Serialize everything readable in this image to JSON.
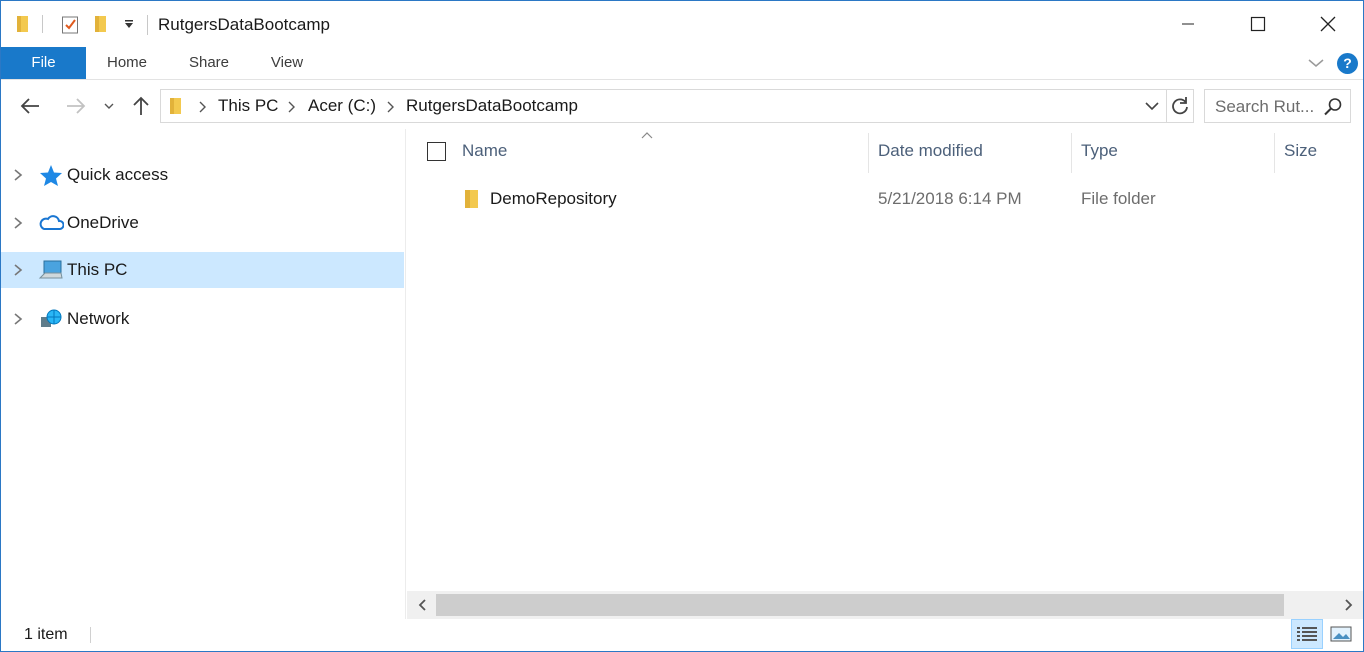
{
  "window": {
    "title": "RutgersDataBootcamp",
    "controls": {
      "minimize": "minimize-icon",
      "maximize": "maximize-icon",
      "close": "close-icon"
    }
  },
  "quick_access_toolbar": [
    "folder-icon",
    "properties-icon",
    "new-folder-icon",
    "customize-dropdown-icon"
  ],
  "ribbon": {
    "tabs": [
      {
        "label": "File",
        "active": true
      },
      {
        "label": "Home"
      },
      {
        "label": "Share"
      },
      {
        "label": "View"
      }
    ],
    "help_label": "?"
  },
  "nav": {
    "breadcrumbs": [
      "This PC",
      "Acer (C:)",
      "RutgersDataBootcamp"
    ],
    "search_placeholder": "Search Rut..."
  },
  "nav_pane": {
    "items": [
      {
        "label": "Quick access",
        "icon": "star-icon",
        "selected": false
      },
      {
        "label": "OneDrive",
        "icon": "cloud-icon",
        "selected": false
      },
      {
        "label": "This PC",
        "icon": "computer-icon",
        "selected": true
      },
      {
        "label": "Network",
        "icon": "network-icon",
        "selected": false
      }
    ]
  },
  "file_list": {
    "columns": [
      "Name",
      "Date modified",
      "Type",
      "Size"
    ],
    "sort_column": "Name",
    "rows": [
      {
        "name": "DemoRepository",
        "date_modified": "5/21/2018 6:14 PM",
        "type": "File folder",
        "size": ""
      }
    ]
  },
  "status": {
    "item_count": "1 item"
  },
  "colors": {
    "accent": "#1979ca",
    "selection": "#cce8ff",
    "header_text": "#4c607a",
    "folder": "#f3c94f"
  }
}
